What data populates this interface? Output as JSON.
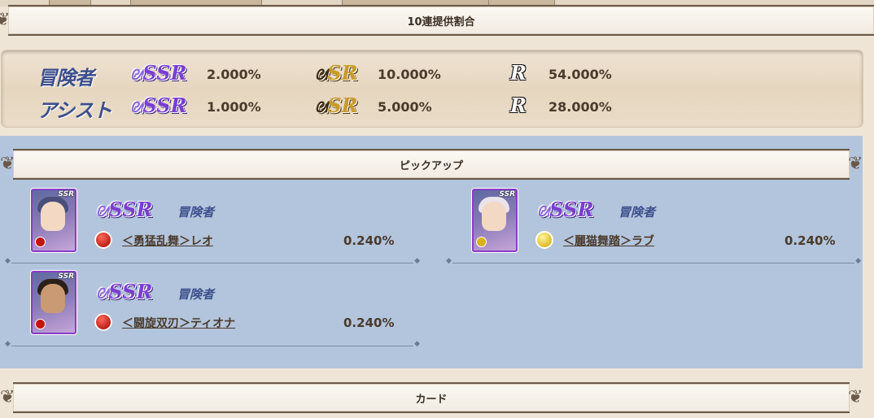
{
  "sections": {
    "rates_header": "10連提供割合",
    "pickup_header": "ピックアップ",
    "card_header": "カード"
  },
  "rates": [
    {
      "category": "冒険者",
      "ssr_label": "SSR",
      "ssr": "2.000%",
      "sr_label": "SR",
      "sr": "10.000%",
      "r_label": "R",
      "r": "54.000%"
    },
    {
      "category": "アシスト",
      "ssr_label": "SSR",
      "ssr": "1.000%",
      "sr_label": "SR",
      "sr": "5.000%",
      "r_label": "R",
      "r": "28.000%"
    }
  ],
  "pickup": [
    {
      "card_tag": "SSR",
      "rarity": "SSR",
      "type": "冒険者",
      "element": "fire",
      "name": "＜勇猛乱舞＞レオ",
      "rate": "0.240%",
      "hair_color": "#4a4e7a"
    },
    {
      "card_tag": "SSR",
      "rarity": "SSR",
      "type": "冒険者",
      "element": "light",
      "name": "＜麗猫舞踏＞ラブ",
      "rate": "0.240%",
      "hair_color": "#e9e4ea"
    },
    {
      "card_tag": "SSR",
      "rarity": "SSR",
      "type": "冒険者",
      "element": "fire",
      "name": "＜闘旋双刃＞ティオナ",
      "rate": "0.240%",
      "hair_color": "#2a2018"
    }
  ],
  "colors": {
    "background": "#efe5d6",
    "pickup_panel": "#b3c5dc",
    "category_text": "#3d4f8c",
    "ssr_purple": "#7a3fd0",
    "sr_gold": "#c89a2a"
  }
}
